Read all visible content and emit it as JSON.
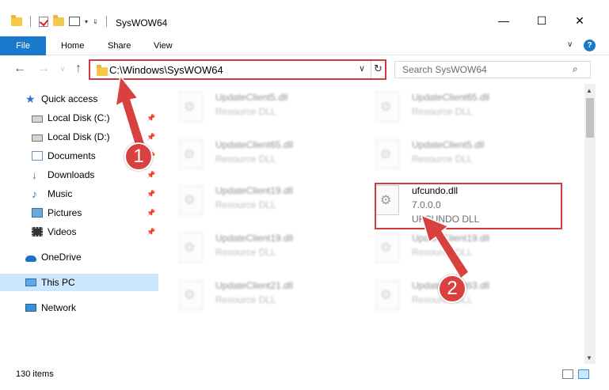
{
  "window": {
    "title": "SysWOW64",
    "minimize": "—",
    "maximize": "☐",
    "close": "✕"
  },
  "ribbon": {
    "file": "File",
    "tabs": [
      "Home",
      "Share",
      "View"
    ],
    "help": "?"
  },
  "nav": {
    "back": "←",
    "forward": "→",
    "up": "↑",
    "address": "C:\\Windows\\SysWOW64",
    "dropdown": "∨",
    "refresh": "↻",
    "search_placeholder": "Search SysWOW64",
    "search_icon": "⌕"
  },
  "sidebar": {
    "items": [
      {
        "label": "Quick access",
        "icon": "star-icon"
      },
      {
        "label": "Local Disk (C:)",
        "icon": "disk-icon",
        "pinned": true
      },
      {
        "label": "Local Disk (D:)",
        "icon": "disk-icon",
        "pinned": true
      },
      {
        "label": "Documents",
        "icon": "documents-icon",
        "pinned": true
      },
      {
        "label": "Downloads",
        "icon": "download-icon",
        "pinned": true
      },
      {
        "label": "Music",
        "icon": "music-icon",
        "pinned": true
      },
      {
        "label": "Pictures",
        "icon": "pictures-icon",
        "pinned": true
      },
      {
        "label": "Videos",
        "icon": "videos-icon",
        "pinned": true
      },
      {
        "label": "OneDrive",
        "icon": "cloud-icon"
      },
      {
        "label": "This PC",
        "icon": "pc-icon",
        "selected": true
      },
      {
        "label": "Network",
        "icon": "network-icon"
      }
    ]
  },
  "files": [
    {
      "name": "UpdateClient5.dll",
      "type": "Resource DLL"
    },
    {
      "name": "UpdateClient65.dll",
      "type": "Resource DLL"
    },
    {
      "name": "UpdateClient65.dll",
      "type": "Resource DLL"
    },
    {
      "name": "UpdateClient5.dll",
      "type": "Resource DLL"
    },
    {
      "name": "UpdateClient19.dll",
      "type": "Resource DLL"
    },
    {
      "name": "ufcundo.dll",
      "version": "7.0.0.0",
      "type": "UFCUNDO DLL",
      "highlighted": true
    },
    {
      "name": "UpdateClient19.dll",
      "type": "Resource DLL"
    },
    {
      "name": "UpdateClient19.dll",
      "type": "Resource DLL"
    },
    {
      "name": "UpdateClient21.dll",
      "type": "Resource DLL"
    },
    {
      "name": "UpdateClient63.dll",
      "type": "Resource DLL"
    }
  ],
  "status": {
    "count": "130 items"
  },
  "annotations": {
    "step1": "1",
    "step2": "2",
    "color": "#d94040"
  }
}
